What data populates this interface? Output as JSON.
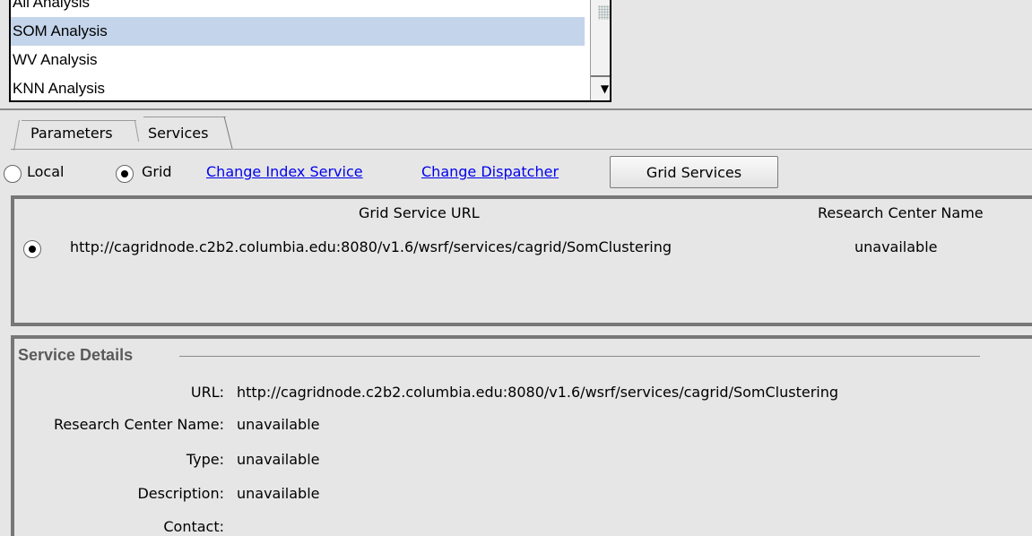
{
  "analysis_list": {
    "items": [
      {
        "label": "All Analysis",
        "selected": false
      },
      {
        "label": "SOM Analysis",
        "selected": true
      },
      {
        "label": "WV Analysis",
        "selected": false
      },
      {
        "label": "KNN Analysis",
        "selected": false
      }
    ]
  },
  "tabs": [
    {
      "label": "Parameters",
      "active": false
    },
    {
      "label": "Services",
      "active": true
    }
  ],
  "mode": {
    "local_label": "Local",
    "grid_label": "Grid",
    "selected": "Grid",
    "change_index_service": "Change Index Service",
    "change_dispatcher": "Change Dispatcher",
    "grid_services_button": "Grid Services"
  },
  "services_table": {
    "columns": [
      "Grid Service URL",
      "Research Center Name"
    ],
    "rows": [
      {
        "url": "http://cagridnode.c2b2.columbia.edu:8080/v1.6/wsrf/services/cagrid/SomClustering",
        "research_center": "unavailable",
        "selected": true
      }
    ]
  },
  "service_details": {
    "title": "Service Details",
    "fields": [
      {
        "key": "URL:",
        "value": "http://cagridnode.c2b2.columbia.edu:8080/v1.6/wsrf/services/cagrid/SomClustering"
      },
      {
        "key": "Research Center Name:",
        "value": "unavailable"
      },
      {
        "key": "Type:",
        "value": "unavailable"
      },
      {
        "key": "Description:",
        "value": "unavailable"
      },
      {
        "key": "Contact:",
        "value": ""
      }
    ]
  },
  "colors": {
    "selection": "#c4d4ea",
    "link": "#0000ee",
    "panel_bg": "#e6e6e6"
  }
}
